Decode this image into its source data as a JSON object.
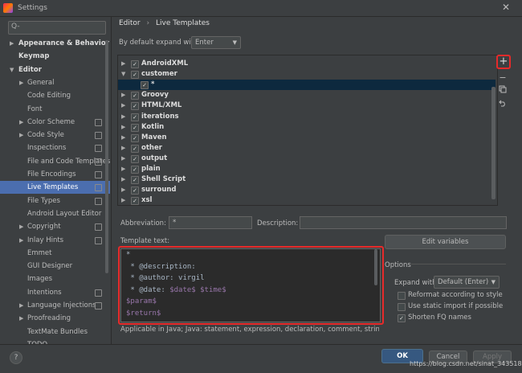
{
  "window": {
    "title": "Settings",
    "close_glyph": "✕"
  },
  "search": {
    "placeholder": "Q-",
    "icon": "search-icon"
  },
  "sidebar": {
    "items": [
      {
        "label": "Appearance & Behavior",
        "expanded": false
      },
      {
        "label": "Keymap"
      },
      {
        "label": "Editor",
        "expanded": true
      },
      {
        "label": "General",
        "expanded": false
      },
      {
        "label": "Code Editing"
      },
      {
        "label": "Font"
      },
      {
        "label": "Color Scheme",
        "expanded": false
      },
      {
        "label": "Code Style",
        "expanded": false
      },
      {
        "label": "Inspections"
      },
      {
        "label": "File and Code Templates"
      },
      {
        "label": "File Encodings"
      },
      {
        "label": "Live Templates",
        "selected": true
      },
      {
        "label": "File Types"
      },
      {
        "label": "Android Layout Editor"
      },
      {
        "label": "Copyright",
        "expanded": false
      },
      {
        "label": "Inlay Hints",
        "expanded": false
      },
      {
        "label": "Emmet"
      },
      {
        "label": "GUI Designer"
      },
      {
        "label": "Images"
      },
      {
        "label": "Intentions"
      },
      {
        "label": "Language Injections",
        "expanded": false
      },
      {
        "label": "Proofreading",
        "expanded": false
      },
      {
        "label": "TextMate Bundles"
      },
      {
        "label": "TODO"
      }
    ]
  },
  "breadcrumb": {
    "parent": "Editor",
    "separator": "›",
    "current": "Live Templates"
  },
  "expand": {
    "label": "By default expand with",
    "value": "Enter"
  },
  "template_tree": [
    {
      "label": "AndroidXML",
      "checked": true,
      "expanded": false
    },
    {
      "label": "customer",
      "checked": true,
      "expanded": true
    },
    {
      "label": "*",
      "checked": true,
      "child": true,
      "selected": true
    },
    {
      "label": "Groovy",
      "checked": true,
      "expanded": false
    },
    {
      "label": "HTML/XML",
      "checked": true,
      "expanded": false
    },
    {
      "label": "iterations",
      "checked": true,
      "expanded": false
    },
    {
      "label": "Kotlin",
      "checked": true,
      "expanded": false
    },
    {
      "label": "Maven",
      "checked": true,
      "expanded": false
    },
    {
      "label": "other",
      "checked": true,
      "expanded": false
    },
    {
      "label": "output",
      "checked": true,
      "expanded": false
    },
    {
      "label": "plain",
      "checked": true,
      "expanded": false
    },
    {
      "label": "Shell Script",
      "checked": true,
      "expanded": false
    },
    {
      "label": "surround",
      "checked": true,
      "expanded": false
    },
    {
      "label": "xsl",
      "checked": true,
      "expanded": false
    }
  ],
  "toolbar": {
    "add": "+",
    "remove": "−",
    "copy": "copy-icon",
    "restore": "restore-icon"
  },
  "abbreviation": {
    "label": "Abbreviation:",
    "value": "*"
  },
  "description": {
    "label": "Description:",
    "value": ""
  },
  "template_text": {
    "label": "Template text:",
    "lines": [
      "*",
      " * @description:",
      " * @author: virgil",
      " * @date: $date$ $time$",
      "$param$",
      "$return$",
      "  "
    ]
  },
  "applicable": "Applicable in Java; Java: statement, expression, declaration, comment, string, smart t",
  "edit_variables": "Edit variables",
  "options": {
    "title": "Options",
    "expand_with_label": "Expand with",
    "expand_with_value": "Default (Enter)",
    "reformat": {
      "label": "Reformat according to style",
      "checked": false
    },
    "static_import": {
      "label": "Use static import if possible",
      "checked": false
    },
    "shorten_fq": {
      "label": "Shorten FQ names",
      "checked": true
    }
  },
  "buttons": {
    "ok": "OK",
    "cancel": "Cancel",
    "apply": "Apply",
    "help": "?"
  },
  "watermark": "https://blog.csdn.net/sinat_34351851",
  "colors": {
    "accent": "#4b6eaf",
    "highlight_red": "#e62a2a",
    "primary_button": "#365880",
    "code_var": "#9876aa"
  }
}
